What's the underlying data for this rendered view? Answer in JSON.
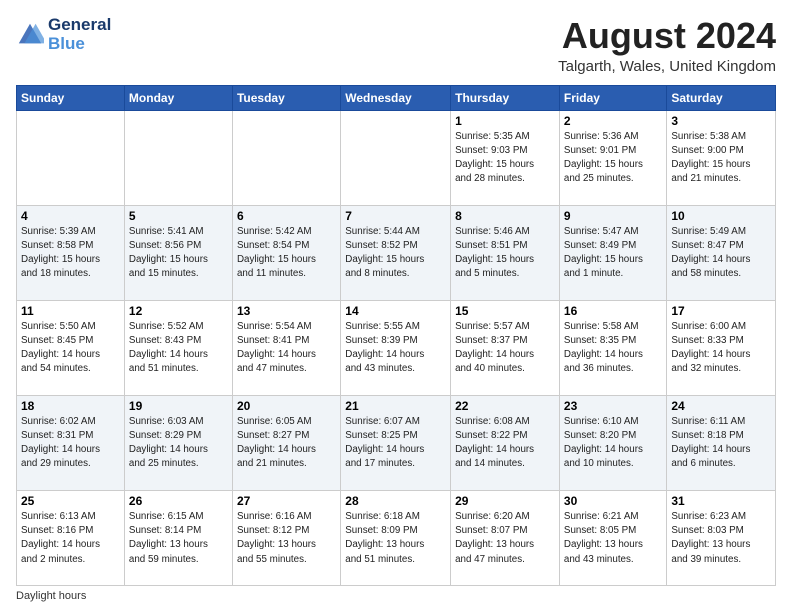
{
  "header": {
    "logo_line1": "General",
    "logo_line2": "Blue",
    "month_title": "August 2024",
    "location": "Talgarth, Wales, United Kingdom"
  },
  "days_of_week": [
    "Sunday",
    "Monday",
    "Tuesday",
    "Wednesday",
    "Thursday",
    "Friday",
    "Saturday"
  ],
  "weeks": [
    [
      {
        "day": "",
        "info": ""
      },
      {
        "day": "",
        "info": ""
      },
      {
        "day": "",
        "info": ""
      },
      {
        "day": "",
        "info": ""
      },
      {
        "day": "1",
        "info": "Sunrise: 5:35 AM\nSunset: 9:03 PM\nDaylight: 15 hours\nand 28 minutes."
      },
      {
        "day": "2",
        "info": "Sunrise: 5:36 AM\nSunset: 9:01 PM\nDaylight: 15 hours\nand 25 minutes."
      },
      {
        "day": "3",
        "info": "Sunrise: 5:38 AM\nSunset: 9:00 PM\nDaylight: 15 hours\nand 21 minutes."
      }
    ],
    [
      {
        "day": "4",
        "info": "Sunrise: 5:39 AM\nSunset: 8:58 PM\nDaylight: 15 hours\nand 18 minutes."
      },
      {
        "day": "5",
        "info": "Sunrise: 5:41 AM\nSunset: 8:56 PM\nDaylight: 15 hours\nand 15 minutes."
      },
      {
        "day": "6",
        "info": "Sunrise: 5:42 AM\nSunset: 8:54 PM\nDaylight: 15 hours\nand 11 minutes."
      },
      {
        "day": "7",
        "info": "Sunrise: 5:44 AM\nSunset: 8:52 PM\nDaylight: 15 hours\nand 8 minutes."
      },
      {
        "day": "8",
        "info": "Sunrise: 5:46 AM\nSunset: 8:51 PM\nDaylight: 15 hours\nand 5 minutes."
      },
      {
        "day": "9",
        "info": "Sunrise: 5:47 AM\nSunset: 8:49 PM\nDaylight: 15 hours\nand 1 minute."
      },
      {
        "day": "10",
        "info": "Sunrise: 5:49 AM\nSunset: 8:47 PM\nDaylight: 14 hours\nand 58 minutes."
      }
    ],
    [
      {
        "day": "11",
        "info": "Sunrise: 5:50 AM\nSunset: 8:45 PM\nDaylight: 14 hours\nand 54 minutes."
      },
      {
        "day": "12",
        "info": "Sunrise: 5:52 AM\nSunset: 8:43 PM\nDaylight: 14 hours\nand 51 minutes."
      },
      {
        "day": "13",
        "info": "Sunrise: 5:54 AM\nSunset: 8:41 PM\nDaylight: 14 hours\nand 47 minutes."
      },
      {
        "day": "14",
        "info": "Sunrise: 5:55 AM\nSunset: 8:39 PM\nDaylight: 14 hours\nand 43 minutes."
      },
      {
        "day": "15",
        "info": "Sunrise: 5:57 AM\nSunset: 8:37 PM\nDaylight: 14 hours\nand 40 minutes."
      },
      {
        "day": "16",
        "info": "Sunrise: 5:58 AM\nSunset: 8:35 PM\nDaylight: 14 hours\nand 36 minutes."
      },
      {
        "day": "17",
        "info": "Sunrise: 6:00 AM\nSunset: 8:33 PM\nDaylight: 14 hours\nand 32 minutes."
      }
    ],
    [
      {
        "day": "18",
        "info": "Sunrise: 6:02 AM\nSunset: 8:31 PM\nDaylight: 14 hours\nand 29 minutes."
      },
      {
        "day": "19",
        "info": "Sunrise: 6:03 AM\nSunset: 8:29 PM\nDaylight: 14 hours\nand 25 minutes."
      },
      {
        "day": "20",
        "info": "Sunrise: 6:05 AM\nSunset: 8:27 PM\nDaylight: 14 hours\nand 21 minutes."
      },
      {
        "day": "21",
        "info": "Sunrise: 6:07 AM\nSunset: 8:25 PM\nDaylight: 14 hours\nand 17 minutes."
      },
      {
        "day": "22",
        "info": "Sunrise: 6:08 AM\nSunset: 8:22 PM\nDaylight: 14 hours\nand 14 minutes."
      },
      {
        "day": "23",
        "info": "Sunrise: 6:10 AM\nSunset: 8:20 PM\nDaylight: 14 hours\nand 10 minutes."
      },
      {
        "day": "24",
        "info": "Sunrise: 6:11 AM\nSunset: 8:18 PM\nDaylight: 14 hours\nand 6 minutes."
      }
    ],
    [
      {
        "day": "25",
        "info": "Sunrise: 6:13 AM\nSunset: 8:16 PM\nDaylight: 14 hours\nand 2 minutes."
      },
      {
        "day": "26",
        "info": "Sunrise: 6:15 AM\nSunset: 8:14 PM\nDaylight: 13 hours\nand 59 minutes."
      },
      {
        "day": "27",
        "info": "Sunrise: 6:16 AM\nSunset: 8:12 PM\nDaylight: 13 hours\nand 55 minutes."
      },
      {
        "day": "28",
        "info": "Sunrise: 6:18 AM\nSunset: 8:09 PM\nDaylight: 13 hours\nand 51 minutes."
      },
      {
        "day": "29",
        "info": "Sunrise: 6:20 AM\nSunset: 8:07 PM\nDaylight: 13 hours\nand 47 minutes."
      },
      {
        "day": "30",
        "info": "Sunrise: 6:21 AM\nSunset: 8:05 PM\nDaylight: 13 hours\nand 43 minutes."
      },
      {
        "day": "31",
        "info": "Sunrise: 6:23 AM\nSunset: 8:03 PM\nDaylight: 13 hours\nand 39 minutes."
      }
    ]
  ],
  "footer": {
    "note": "Daylight hours"
  }
}
